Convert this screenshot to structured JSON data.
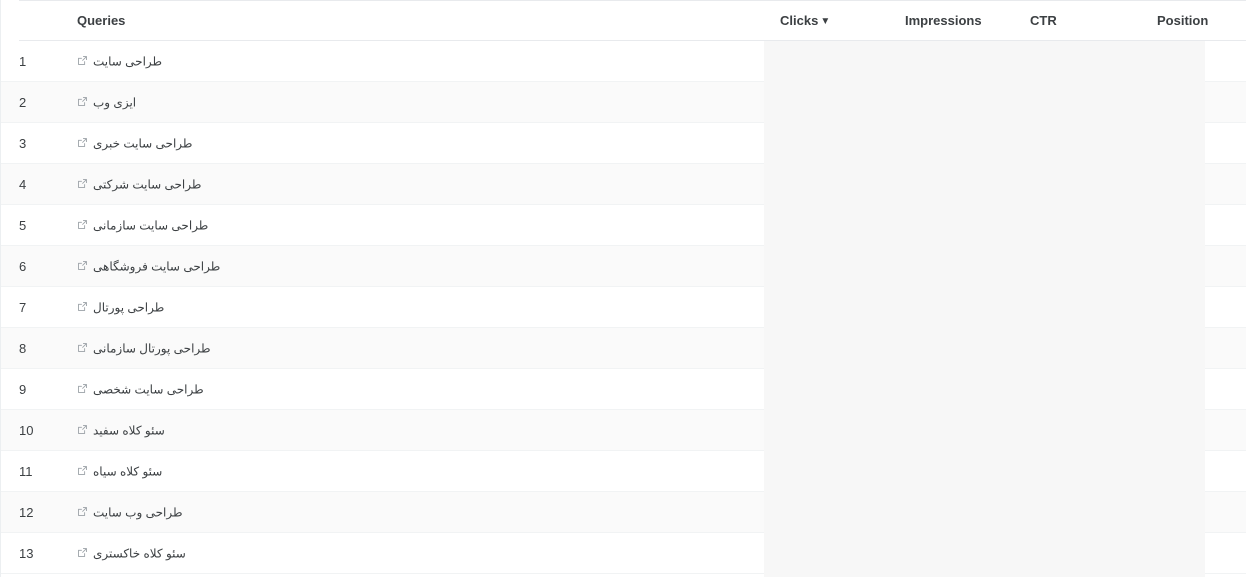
{
  "table": {
    "columns": {
      "index_label": "",
      "queries": "Queries",
      "clicks": "Clicks",
      "clicks_sort_caret": "▼",
      "impressions": "Impressions",
      "ctr": "CTR",
      "position": "Position"
    },
    "row_icon": "external-link-icon",
    "rows": [
      {
        "index": "1",
        "query": "طراحی سایت",
        "clicks": "",
        "impressions": "",
        "ctr": "",
        "position": ""
      },
      {
        "index": "2",
        "query": "ایزی وب",
        "clicks": "",
        "impressions": "",
        "ctr": "",
        "position": ""
      },
      {
        "index": "3",
        "query": "طراحی سایت خبری",
        "clicks": "",
        "impressions": "",
        "ctr": "",
        "position": ""
      },
      {
        "index": "4",
        "query": "طراحی سایت شرکتی",
        "clicks": "",
        "impressions": "",
        "ctr": "",
        "position": ""
      },
      {
        "index": "5",
        "query": "طراحی سایت سازمانی",
        "clicks": "",
        "impressions": "",
        "ctr": "",
        "position": ""
      },
      {
        "index": "6",
        "query": "طراحی سایت فروشگاهی",
        "clicks": "",
        "impressions": "",
        "ctr": "",
        "position": ""
      },
      {
        "index": "7",
        "query": "طراحی پورتال",
        "clicks": "",
        "impressions": "",
        "ctr": "",
        "position": ""
      },
      {
        "index": "8",
        "query": "طراحی پورتال سازمانی",
        "clicks": "",
        "impressions": "",
        "ctr": "",
        "position": ""
      },
      {
        "index": "9",
        "query": "طراحی سایت شخصی",
        "clicks": "",
        "impressions": "",
        "ctr": "",
        "position": ""
      },
      {
        "index": "10",
        "query": "سئو کلاه سفید",
        "clicks": "",
        "impressions": "",
        "ctr": "",
        "position": ""
      },
      {
        "index": "11",
        "query": "سئو کلاه سیاه",
        "clicks": "",
        "impressions": "",
        "ctr": "",
        "position": ""
      },
      {
        "index": "12",
        "query": "طراحی وب سایت",
        "clicks": "",
        "impressions": "",
        "ctr": "",
        "position": ""
      },
      {
        "index": "13",
        "query": "سئو کلاه خاکستری",
        "clicks": "",
        "impressions": "",
        "ctr": "",
        "position": ""
      }
    ]
  },
  "colors": {
    "row_alt_background": "#fafafa",
    "row_border": "#f1f3f4",
    "header_border": "#e8eaed",
    "metrics_block_background": "#f7f7f7",
    "text": "#3c4043"
  }
}
